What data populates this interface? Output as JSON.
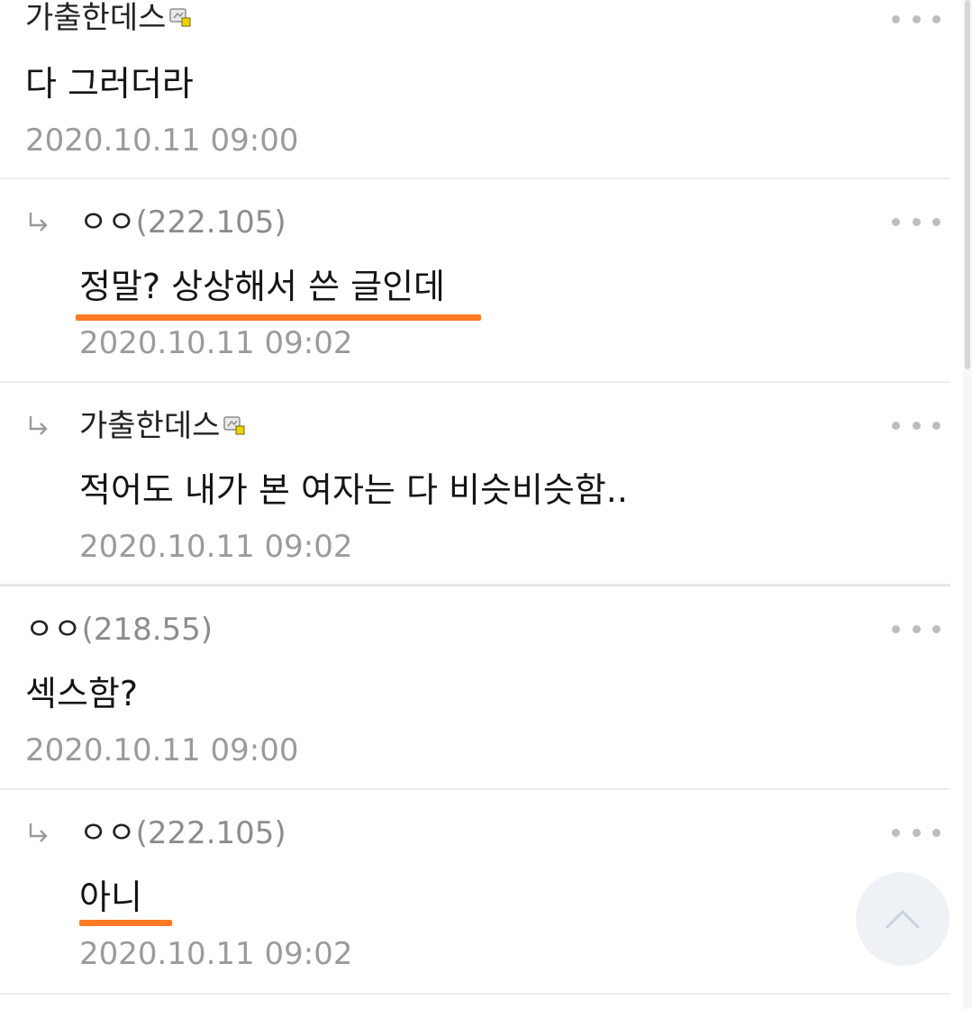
{
  "comments": [
    {
      "author": "가출한데스",
      "author_badge_icon": "member-badge-icon",
      "text": "다 그러더라",
      "time": "2020.10.11 09:00"
    },
    {
      "is_reply": true,
      "reply_icon": "reply-arrow-icon",
      "author": "ㅇㅇ",
      "ip": "(222.105)",
      "text": "정말? 상상해서 쓴 글인데",
      "time": "2020.10.11 09:02",
      "highlighted": true
    },
    {
      "is_reply": true,
      "reply_icon": "reply-arrow-icon",
      "author": "가출한데스",
      "author_badge_icon": "member-badge-icon",
      "text": "적어도 내가 본 여자는 다 비슷비슷함..",
      "time": "2020.10.11 09:02"
    },
    {
      "author": "ㅇㅇ",
      "ip": "(218.55)",
      "text": "섹스함?",
      "time": "2020.10.11 09:00"
    },
    {
      "is_reply": true,
      "reply_icon": "reply-arrow-icon",
      "author": "ㅇㅇ",
      "ip": "(222.105)",
      "text": "아니",
      "time": "2020.10.11 09:02",
      "highlighted": true
    }
  ],
  "more_icon": "more-dots-icon",
  "scroll_top_icon": "chevron-up-icon",
  "colors": {
    "highlight": "#ff7a22",
    "timestamp": "#9b9b9b",
    "ip": "#8c8c8c",
    "divider": "#ececec",
    "scroll_top_bg": "#eef2f7"
  }
}
